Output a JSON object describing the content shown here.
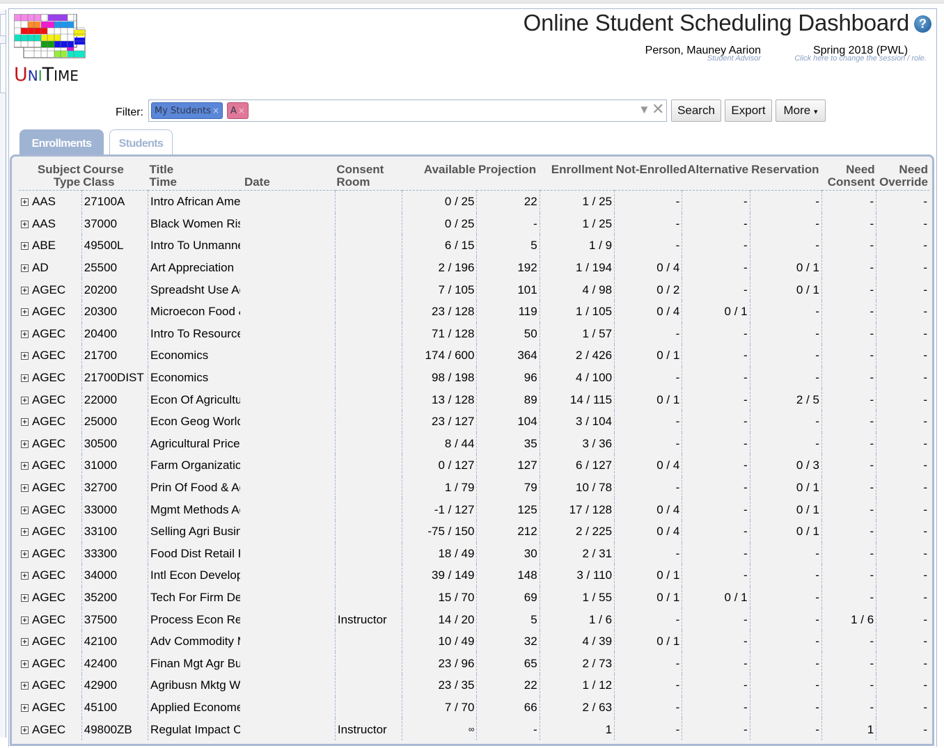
{
  "header": {
    "app_logo": "UniTime",
    "title": "Online Student Scheduling Dashboard",
    "help_icon": "help-icon",
    "user": {
      "name": "Person, Mauney Aarion",
      "role": "Student Advisor"
    },
    "session": {
      "name": "Spring 2018 (PWL)",
      "hint": "Click here to change the session / role."
    }
  },
  "filter": {
    "label": "Filter:",
    "chips": [
      {
        "label": "My Students",
        "remove": "×",
        "color": "#5b87d8"
      },
      {
        "label": "A",
        "remove": "×",
        "color": "#e0789a"
      }
    ],
    "input_value": "",
    "dropdown_icon": "▼",
    "clear_icon": "✕"
  },
  "toolbar": {
    "search_label": "Search",
    "export_label": "Export",
    "more_label": "More",
    "more_arrow": "▾"
  },
  "tabs": [
    {
      "label": "Enrollments",
      "active": true
    },
    {
      "label": "Students",
      "active": false
    }
  ],
  "table": {
    "headers": {
      "subject": [
        "Subject",
        "Type"
      ],
      "course": [
        "Course",
        "Class"
      ],
      "title": [
        "Title",
        "Time"
      ],
      "date": "Date",
      "consent": [
        "Consent",
        "Room"
      ],
      "available": "Available",
      "projection": "Projection",
      "enrollment": "Enrollment",
      "not_enrolled": "Not-Enrolled",
      "alternative": "Alternative",
      "reservation": "Reservation",
      "need_consent": [
        "Need",
        "Consent"
      ],
      "need_override": [
        "Need",
        "Override"
      ]
    },
    "expand_icon": "+",
    "rows": [
      {
        "subject": "AAS",
        "course": "27100A",
        "title": "Intro African American Studies",
        "consent": "",
        "available": "0 / 25",
        "projection": "22",
        "enrollment": "1 / 25",
        "not_enrolled": "-",
        "alternative": "-",
        "reservation": "-",
        "need_consent": "-",
        "need_override": "-"
      },
      {
        "subject": "AAS",
        "course": "37000",
        "title": "Black Women Rising",
        "consent": "",
        "available": "0 / 25",
        "projection": "-",
        "enrollment": "1 / 25",
        "not_enrolled": "-",
        "alternative": "-",
        "reservation": "-",
        "need_consent": "-",
        "need_override": "-"
      },
      {
        "subject": "ABE",
        "course": "49500L",
        "title": "Intro To Unmanned Aircraft Sys",
        "consent": "",
        "available": "6 / 15",
        "projection": "5",
        "enrollment": "1 / 9",
        "not_enrolled": "-",
        "alternative": "-",
        "reservation": "-",
        "need_consent": "-",
        "need_override": "-"
      },
      {
        "subject": "AD",
        "course": "25500",
        "title": "Art Appreciation",
        "consent": "",
        "available": "2 / 196",
        "projection": "192",
        "enrollment": "1 / 194",
        "not_enrolled": "0 / 4",
        "alternative": "-",
        "reservation": "0 / 1",
        "need_consent": "-",
        "need_override": "-"
      },
      {
        "subject": "AGEC",
        "course": "20200",
        "title": "Spreadsht Use Agr Bus",
        "consent": "",
        "available": "7 / 105",
        "projection": "101",
        "enrollment": "4 / 98",
        "not_enrolled": "0 / 2",
        "alternative": "-",
        "reservation": "0 / 1",
        "need_consent": "-",
        "need_override": "-"
      },
      {
        "subject": "AGEC",
        "course": "20300",
        "title": "Microecon Food & Agbus",
        "consent": "",
        "available": "23 / 128",
        "projection": "119",
        "enrollment": "1 / 105",
        "not_enrolled": "0 / 4",
        "alternative": "0 / 1",
        "reservation": "-",
        "need_consent": "-",
        "need_override": "-"
      },
      {
        "subject": "AGEC",
        "course": "20400",
        "title": "Intro To Resource Econ",
        "consent": "",
        "available": "71 / 128",
        "projection": "50",
        "enrollment": "1 / 57",
        "not_enrolled": "-",
        "alternative": "-",
        "reservation": "-",
        "need_consent": "-",
        "need_override": "-"
      },
      {
        "subject": "AGEC",
        "course": "21700",
        "title": "Economics",
        "consent": "",
        "available": "174 / 600",
        "projection": "364",
        "enrollment": "2 / 426",
        "not_enrolled": "0 / 1",
        "alternative": "-",
        "reservation": "-",
        "need_consent": "-",
        "need_override": "-"
      },
      {
        "subject": "AGEC",
        "course": "21700DIST",
        "title": "Economics",
        "consent": "",
        "available": "98 / 198",
        "projection": "96",
        "enrollment": "4 / 100",
        "not_enrolled": "-",
        "alternative": "-",
        "reservation": "-",
        "need_consent": "-",
        "need_override": "-"
      },
      {
        "subject": "AGEC",
        "course": "22000",
        "title": "Econ Of Agricultural Markets",
        "consent": "",
        "available": "13 / 128",
        "projection": "89",
        "enrollment": "14 / 115",
        "not_enrolled": "0 / 1",
        "alternative": "-",
        "reservation": "2 / 5",
        "need_consent": "-",
        "need_override": "-"
      },
      {
        "subject": "AGEC",
        "course": "25000",
        "title": "Econ Geog World Food",
        "consent": "",
        "available": "23 / 127",
        "projection": "104",
        "enrollment": "3 / 104",
        "not_enrolled": "-",
        "alternative": "-",
        "reservation": "-",
        "need_consent": "-",
        "need_override": "-"
      },
      {
        "subject": "AGEC",
        "course": "30500",
        "title": "Agricultural Prices",
        "consent": "",
        "available": "8 / 44",
        "projection": "35",
        "enrollment": "3 / 36",
        "not_enrolled": "-",
        "alternative": "-",
        "reservation": "-",
        "need_consent": "-",
        "need_override": "-"
      },
      {
        "subject": "AGEC",
        "course": "31000",
        "title": "Farm Organization",
        "consent": "",
        "available": "0 / 127",
        "projection": "127",
        "enrollment": "6 / 127",
        "not_enrolled": "0 / 4",
        "alternative": "-",
        "reservation": "0 / 3",
        "need_consent": "-",
        "need_override": "-"
      },
      {
        "subject": "AGEC",
        "course": "32700",
        "title": "Prin Of Food & Agribus Mrkt",
        "consent": "",
        "available": "1 / 79",
        "projection": "79",
        "enrollment": "10 / 78",
        "not_enrolled": "-",
        "alternative": "-",
        "reservation": "0 / 1",
        "need_consent": "-",
        "need_override": "-"
      },
      {
        "subject": "AGEC",
        "course": "33000",
        "title": "Mgmt Methods Agr Bus",
        "consent": "",
        "available": "-1 / 127",
        "projection": "125",
        "enrollment": "17 / 128",
        "not_enrolled": "0 / 4",
        "alternative": "-",
        "reservation": "0 / 1",
        "need_consent": "-",
        "need_override": "-"
      },
      {
        "subject": "AGEC",
        "course": "33100",
        "title": "Selling Agri Business",
        "consent": "",
        "available": "-75 / 150",
        "projection": "212",
        "enrollment": "2 / 225",
        "not_enrolled": "0 / 4",
        "alternative": "-",
        "reservation": "0 / 1",
        "need_consent": "-",
        "need_override": "-"
      },
      {
        "subject": "AGEC",
        "course": "33300",
        "title": "Food Dist Retail Persp",
        "consent": "",
        "available": "18 / 49",
        "projection": "30",
        "enrollment": "2 / 31",
        "not_enrolled": "-",
        "alternative": "-",
        "reservation": "-",
        "need_consent": "-",
        "need_override": "-"
      },
      {
        "subject": "AGEC",
        "course": "34000",
        "title": "Intl Econ Development",
        "consent": "",
        "available": "39 / 149",
        "projection": "148",
        "enrollment": "3 / 110",
        "not_enrolled": "0 / 1",
        "alternative": "-",
        "reservation": "-",
        "need_consent": "-",
        "need_override": "-"
      },
      {
        "subject": "AGEC",
        "course": "35200",
        "title": "Tech For Firm Decision",
        "consent": "",
        "available": "15 / 70",
        "projection": "69",
        "enrollment": "1 / 55",
        "not_enrolled": "0 / 1",
        "alternative": "0 / 1",
        "reservation": "-",
        "need_consent": "-",
        "need_override": "-"
      },
      {
        "subject": "AGEC",
        "course": "37500",
        "title": "Process Econ Research",
        "consent": "Instructor",
        "available": "14 / 20",
        "projection": "5",
        "enrollment": "1 / 6",
        "not_enrolled": "-",
        "alternative": "-",
        "reservation": "-",
        "need_consent": "1 / 6",
        "need_override": "-"
      },
      {
        "subject": "AGEC",
        "course": "42100",
        "title": "Adv Commodity Marketing",
        "consent": "",
        "available": "10 / 49",
        "projection": "32",
        "enrollment": "4 / 39",
        "not_enrolled": "0 / 1",
        "alternative": "-",
        "reservation": "-",
        "need_consent": "-",
        "need_override": "-"
      },
      {
        "subject": "AGEC",
        "course": "42400",
        "title": "Finan Mgt Agr Bus",
        "consent": "",
        "available": "23 / 96",
        "projection": "65",
        "enrollment": "2 / 73",
        "not_enrolled": "-",
        "alternative": "-",
        "reservation": "-",
        "need_consent": "-",
        "need_override": "-"
      },
      {
        "subject": "AGEC",
        "course": "42900",
        "title": "Agribusn Mktg Workshop",
        "consent": "",
        "available": "23 / 35",
        "projection": "22",
        "enrollment": "1 / 12",
        "not_enrolled": "-",
        "alternative": "-",
        "reservation": "-",
        "need_consent": "-",
        "need_override": "-"
      },
      {
        "subject": "AGEC",
        "course": "45100",
        "title": "Applied Econometrics",
        "consent": "",
        "available": "7 / 70",
        "projection": "66",
        "enrollment": "2 / 63",
        "not_enrolled": "-",
        "alternative": "-",
        "reservation": "-",
        "need_consent": "-",
        "need_override": "-"
      },
      {
        "subject": "AGEC",
        "course": "49800ZB",
        "title": "Regulat Impact Crop Prod Innov",
        "consent": "Instructor",
        "available": "∞",
        "projection": "-",
        "enrollment": "1",
        "not_enrolled": "-",
        "alternative": "-",
        "reservation": "-",
        "need_consent": "1",
        "need_override": "-"
      }
    ]
  }
}
